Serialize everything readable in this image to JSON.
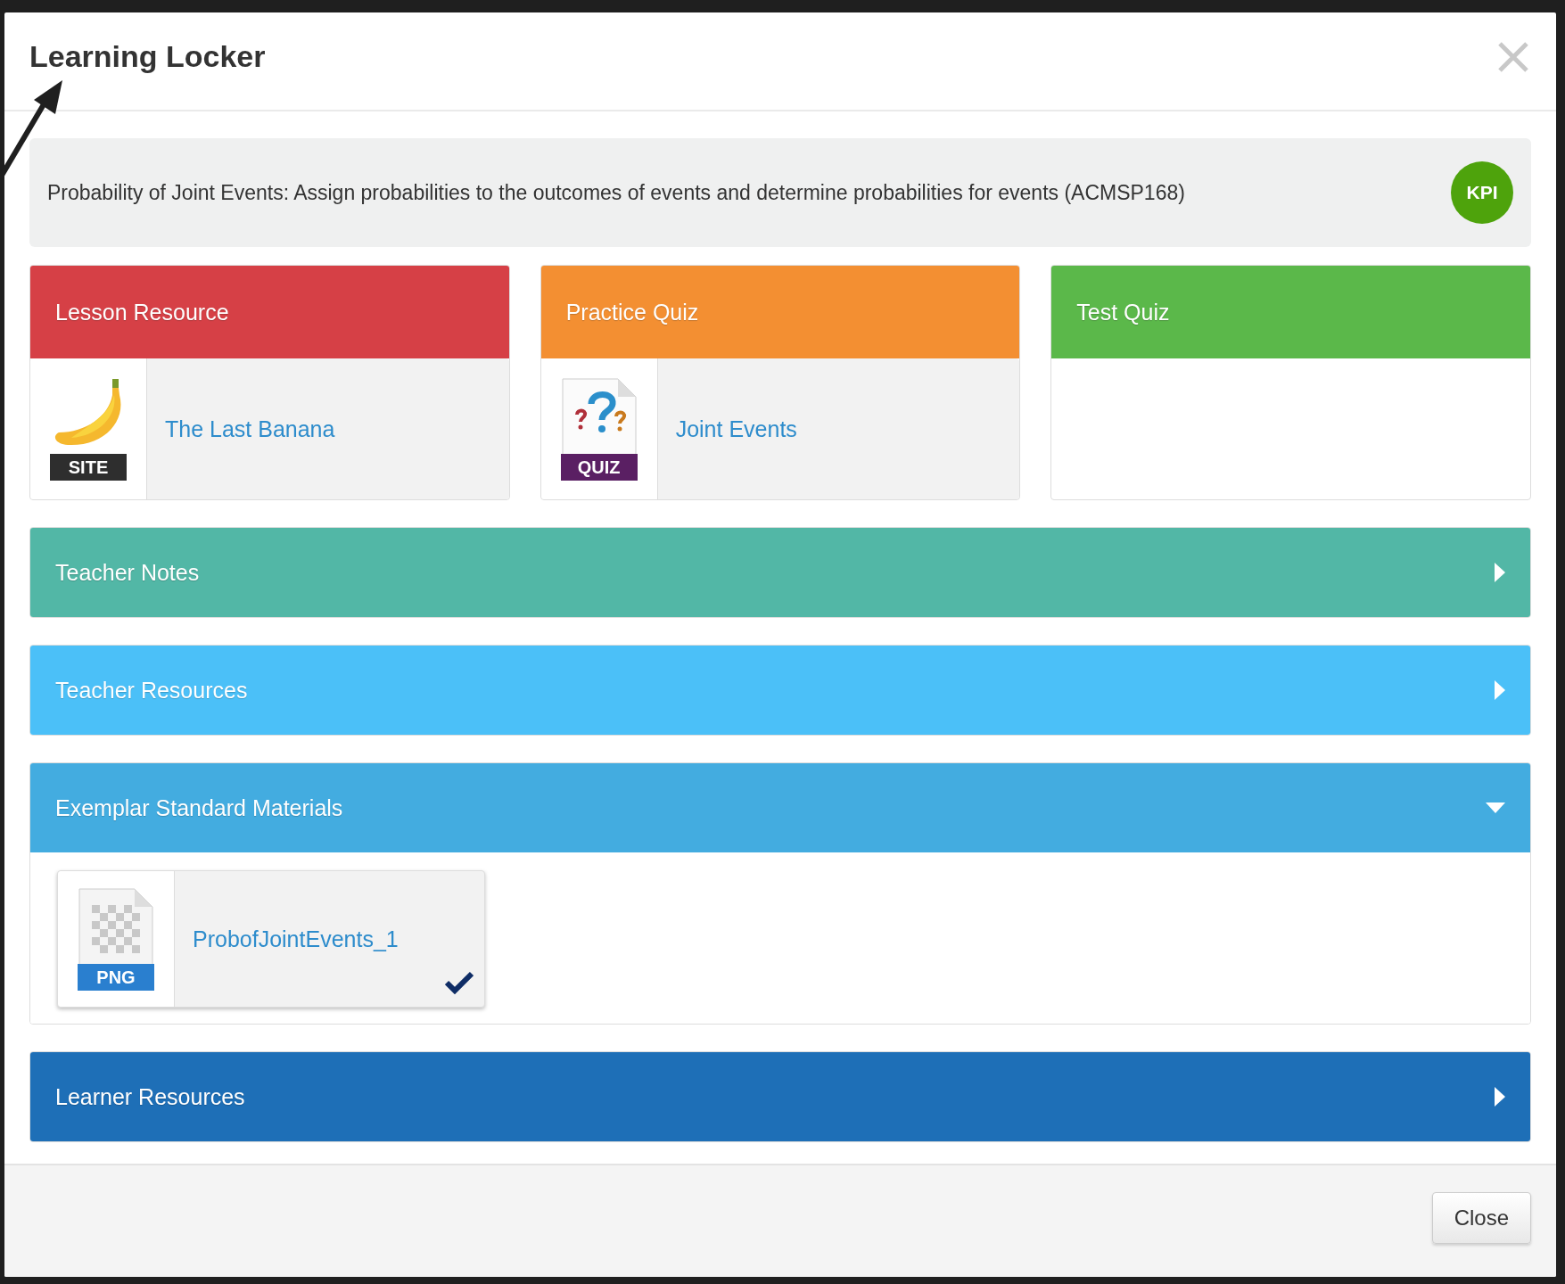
{
  "dialog": {
    "title": "Learning Locker"
  },
  "outcome": {
    "text": "Probability of Joint Events: Assign probabilities to the outcomes of events and determine probabilities for events (ACMSP168)",
    "badge": "KPI"
  },
  "cards": [
    {
      "title": "Lesson Resource",
      "color": "#d64046",
      "items": [
        {
          "kind": "site",
          "badge": "SITE",
          "link": "The Last Banana"
        }
      ]
    },
    {
      "title": "Practice Quiz",
      "color": "#f38f32",
      "items": [
        {
          "kind": "quiz",
          "badge": "QUIZ",
          "link": "Joint Events"
        }
      ]
    },
    {
      "title": "Test Quiz",
      "color": "#5bb84a"
    }
  ],
  "sections": [
    {
      "title": "Teacher Notes",
      "color": "#52b7a6",
      "expanded": false
    },
    {
      "title": "Teacher Resources",
      "color": "#4bc0f8",
      "expanded": false
    },
    {
      "title": "Exemplar Standard Materials",
      "color": "#43ace0",
      "expanded": true,
      "items": [
        {
          "kind": "png",
          "badge": "PNG",
          "link": "ProbofJointEvents_1",
          "checked": true
        }
      ]
    },
    {
      "title": "Learner Resources",
      "color": "#1e6fb7",
      "expanded": false
    }
  ],
  "footer": {
    "button": "Close"
  }
}
